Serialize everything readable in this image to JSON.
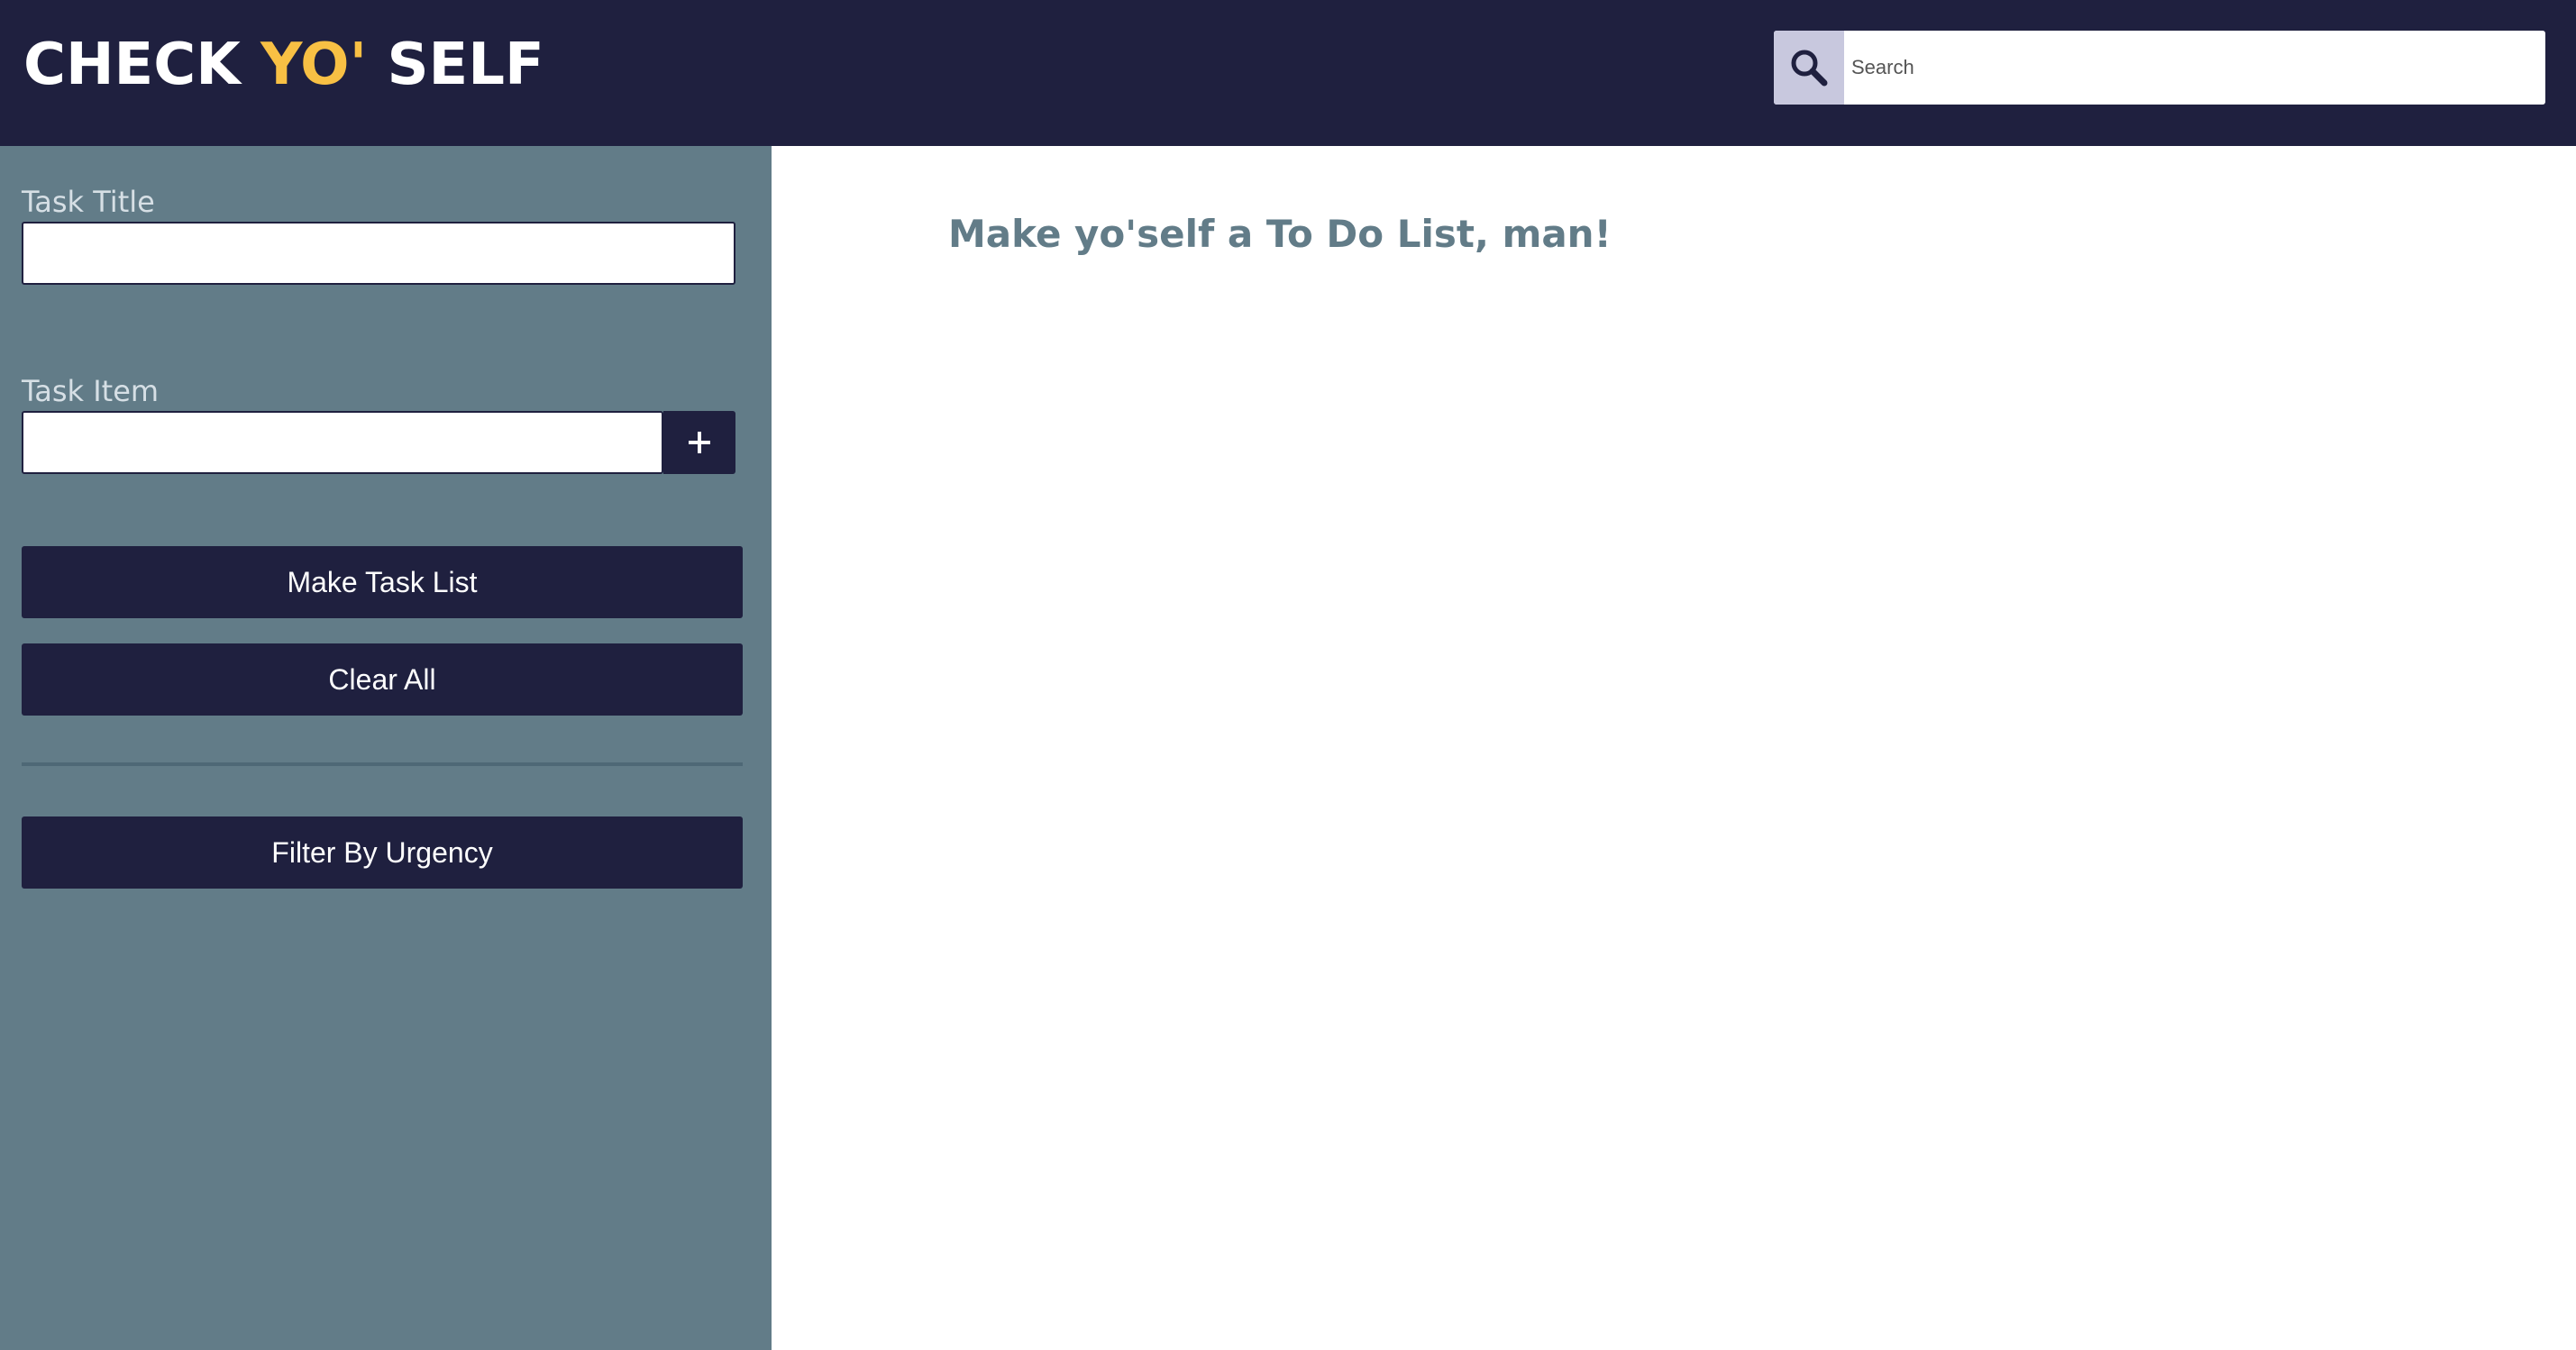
{
  "header": {
    "logo_part1": "CHECK ",
    "logo_accent": "YO'",
    "logo_part2": " SELF",
    "search": {
      "icon": "search-icon",
      "placeholder": "Search",
      "value": ""
    }
  },
  "sidebar": {
    "task_title_label": "Task Title",
    "task_title_value": "",
    "task_item_label": "Task Item",
    "task_item_value": "",
    "add_item_button": "+",
    "make_task_list_button": "Make Task List",
    "clear_all_button": "Clear All",
    "filter_button": "Filter By Urgency"
  },
  "main": {
    "empty_message": "Make yo'self a To Do List, man!"
  },
  "colors": {
    "navy": "#1f203f",
    "slate": "#627c88",
    "accent_yellow": "#f8c044",
    "search_button_bg": "#c8c8de"
  }
}
